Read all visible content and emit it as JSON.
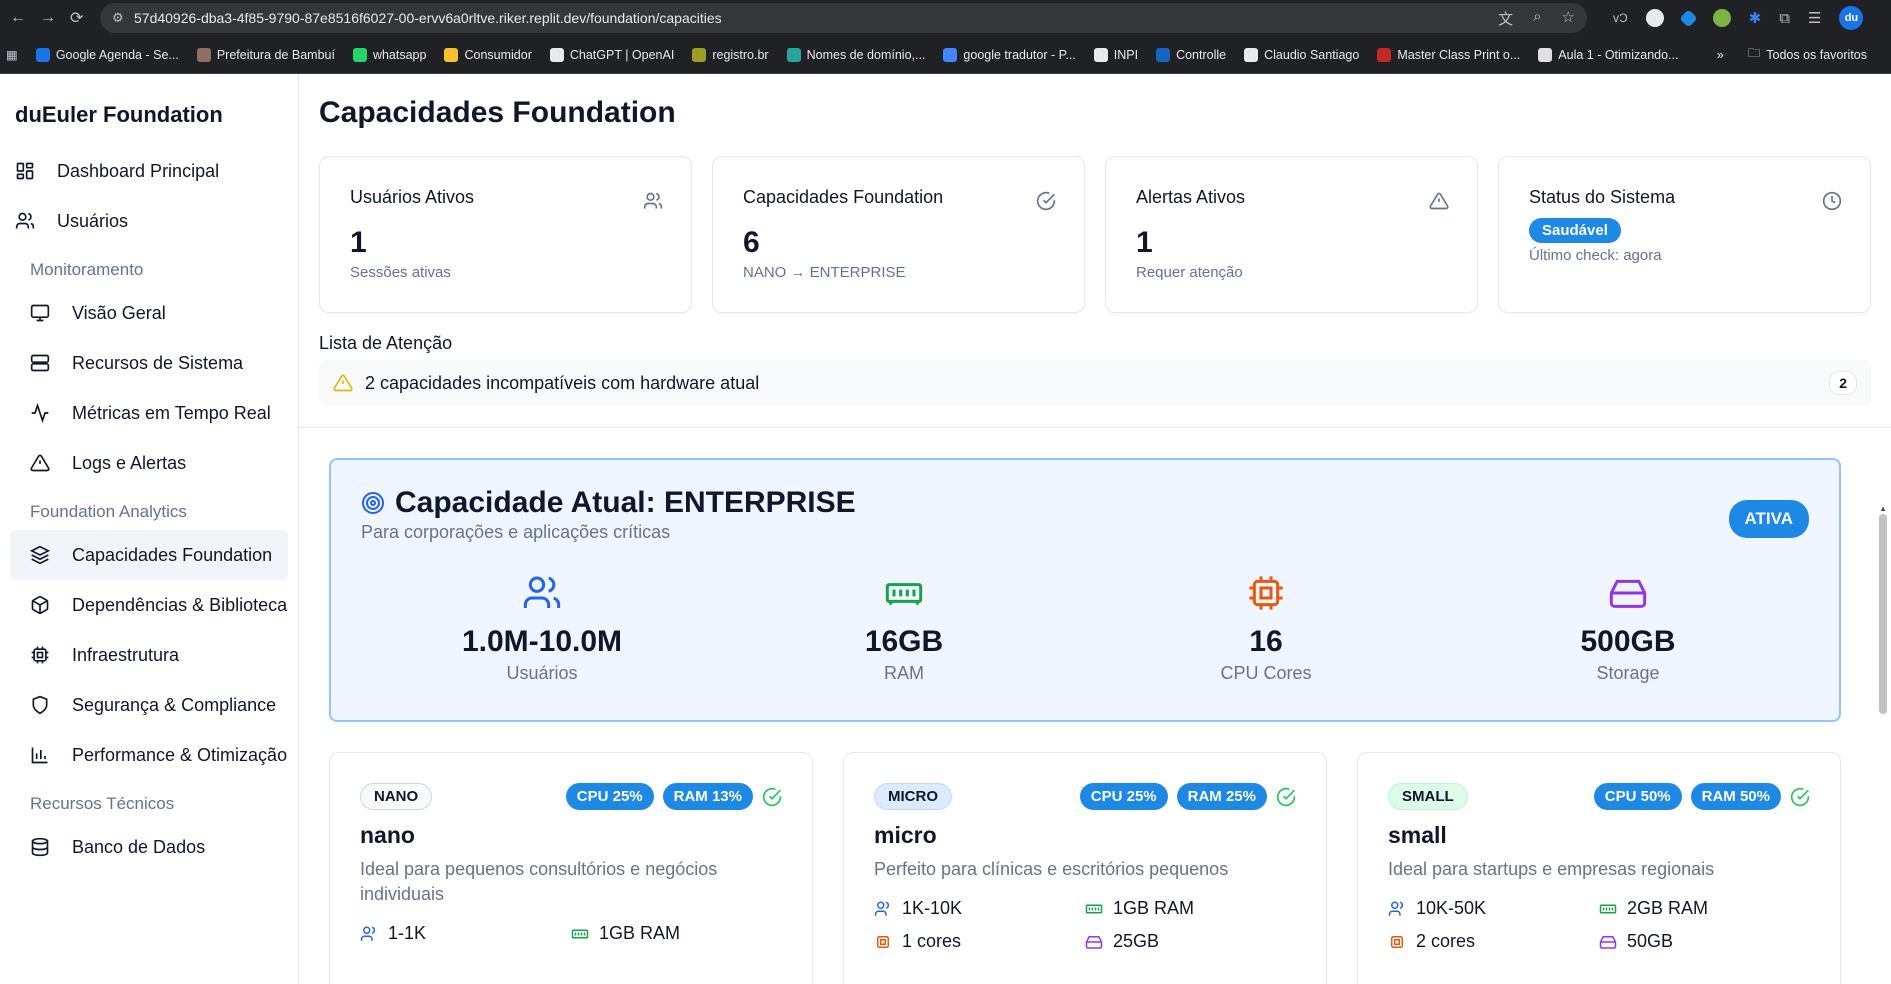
{
  "browser": {
    "url": "57d40926-dba3-4f85-9790-87e8516f6027-00-ervv6a0rltve.riker.replit.dev/foundation/capacities",
    "profile_initials": "du",
    "bookmarks": [
      {
        "label": "Google Agenda - Se...",
        "color": "#1a73e8"
      },
      {
        "label": "Prefeitura de Bambuí",
        "color": "#8d6e63"
      },
      {
        "label": "whatsapp",
        "color": "#25d366"
      },
      {
        "label": "Consumidor",
        "color": "#fbc02d"
      },
      {
        "label": "ChatGPT | OpenAI",
        "color": "#e8eaed"
      },
      {
        "label": "registro.br",
        "color": "#9e9d24"
      },
      {
        "label": "Nomes de domínio,...",
        "color": "#26a69a"
      },
      {
        "label": "google tradutor - P...",
        "color": "#4285f4"
      },
      {
        "label": "INPI",
        "color": "#e8eaed"
      },
      {
        "label": "Controlle",
        "color": "#1565c0"
      },
      {
        "label": "Claudio Santiago",
        "color": "#e8eaed"
      },
      {
        "label": "Master Class Print o...",
        "color": "#c62828"
      },
      {
        "label": "Aula 1 - Otimizando...",
        "color": "#e0e0e0"
      }
    ],
    "all_bookmarks_label": "Todos os favoritos",
    "more_label": "»"
  },
  "sidebar": {
    "brand": "duEuler Foundation",
    "top_items": [
      {
        "label": "Dashboard Principal",
        "icon": "dashboard-icon"
      },
      {
        "label": "Usuários",
        "icon": "users-icon"
      }
    ],
    "sections": [
      {
        "title": "Monitoramento",
        "items": [
          {
            "label": "Visão Geral",
            "icon": "monitor-icon"
          },
          {
            "label": "Recursos de Sistema",
            "icon": "server-icon"
          },
          {
            "label": "Métricas em Tempo Real",
            "icon": "activity-icon"
          },
          {
            "label": "Logs e Alertas",
            "icon": "alert-icon"
          }
        ]
      },
      {
        "title": "Foundation Analytics",
        "items": [
          {
            "label": "Capacidades Foundation",
            "icon": "layers-icon",
            "active": true
          },
          {
            "label": "Dependências & Bibliotecas",
            "icon": "package-icon"
          },
          {
            "label": "Infraestrutura",
            "icon": "cpu-icon"
          },
          {
            "label": "Segurança & Compliance",
            "icon": "shield-icon"
          },
          {
            "label": "Performance & Otimização",
            "icon": "bar-chart-icon"
          }
        ]
      },
      {
        "title": "Recursos Técnicos",
        "items": [
          {
            "label": "Banco de Dados",
            "icon": "database-icon"
          }
        ]
      }
    ]
  },
  "page": {
    "title": "Capacidades Foundation",
    "stats": [
      {
        "title": "Usuários Ativos",
        "value": "1",
        "sub": "Sessões ativas",
        "icon": "users-icon"
      },
      {
        "title": "Capacidades Foundation",
        "value": "6",
        "sub": "NANO → ENTERPRISE",
        "icon": "check-circle-icon"
      },
      {
        "title": "Alertas Ativos",
        "value": "1",
        "sub": "Requer atenção",
        "icon": "alert-icon"
      }
    ],
    "status": {
      "title": "Status do Sistema",
      "badge": "Saudável",
      "check": "Último check: agora",
      "icon": "clock-icon"
    },
    "attention": {
      "title": "Lista de Atenção",
      "message": "2 capacidades incompatíveis com hardware atual",
      "count": "2"
    },
    "current": {
      "title": "Capacidade Atual: ENTERPRISE",
      "description": "Para corporações e aplicações críticas",
      "badge": "ATIVA",
      "metrics": [
        {
          "value": "1.0M-10.0M",
          "label": "Usuários",
          "icon": "users-icon",
          "color": "#2563eb"
        },
        {
          "value": "16GB",
          "label": "RAM",
          "icon": "ram-icon",
          "color": "#16a34a"
        },
        {
          "value": "16",
          "label": "CPU Cores",
          "icon": "cpu-icon",
          "color": "#ea580c"
        },
        {
          "value": "500GB",
          "label": "Storage",
          "icon": "hard-drive-icon",
          "color": "#9333ea"
        }
      ]
    },
    "cards": [
      {
        "tier": "NANO",
        "name": "nano",
        "cpu": "CPU 25%",
        "ram": "RAM 13%",
        "desc": "Ideal para pequenos consultórios e negócios individuais",
        "users": "1-1K",
        "ram_spec": "1GB RAM",
        "cores": "",
        "storage": ""
      },
      {
        "tier": "MICRO",
        "name": "micro",
        "cpu": "CPU 25%",
        "ram": "RAM 25%",
        "desc": "Perfeito para clínicas e escritórios pequenos",
        "users": "1K-10K",
        "ram_spec": "1GB RAM",
        "cores": "1 cores",
        "storage": "25GB"
      },
      {
        "tier": "SMALL",
        "name": "small",
        "cpu": "CPU 50%",
        "ram": "RAM 50%",
        "desc": "Ideal para startups e empresas regionais",
        "users": "10K-50K",
        "ram_spec": "2GB RAM",
        "cores": "2 cores",
        "storage": "50GB"
      }
    ]
  }
}
